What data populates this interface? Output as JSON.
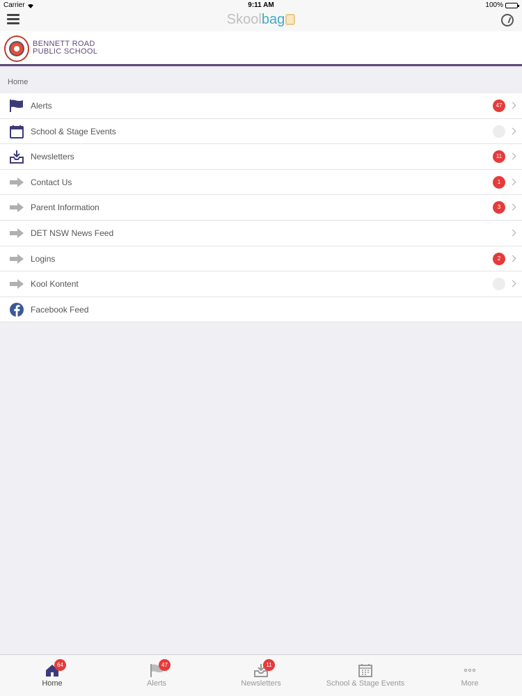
{
  "status_bar": {
    "carrier": "Carrier",
    "time": "9:11 AM",
    "battery": "100%"
  },
  "nav": {
    "brand_part1": "Skool",
    "brand_part2": "bag"
  },
  "school": {
    "name_line1": "BENNETT ROAD",
    "name_line2": "PUBLIC SCHOOL"
  },
  "breadcrumb": "Home",
  "menu": {
    "items": [
      {
        "label": "Alerts",
        "badge": "47",
        "icon": "flag-icon"
      },
      {
        "label": "School & Stage Events",
        "badge": "",
        "icon": "calendar-icon"
      },
      {
        "label": "Newsletters",
        "badge": "11",
        "icon": "inbox-download-icon"
      },
      {
        "label": "Contact Us",
        "badge": "1",
        "icon": "arrow-right-icon"
      },
      {
        "label": "Parent Information",
        "badge": "3",
        "icon": "arrow-right-icon"
      },
      {
        "label": "DET NSW News Feed",
        "badge": "",
        "icon": "arrow-right-icon"
      },
      {
        "label": "Logins",
        "badge": "2",
        "icon": "arrow-right-icon"
      },
      {
        "label": "Kool Kontent",
        "badge": "",
        "icon": "arrow-right-icon"
      },
      {
        "label": "Facebook Feed",
        "badge": "",
        "icon": "facebook-icon"
      }
    ]
  },
  "tabs": [
    {
      "label": "Home",
      "badge": "64",
      "icon": "home-icon"
    },
    {
      "label": "Alerts",
      "badge": "47",
      "icon": "flag-icon"
    },
    {
      "label": "Newsletters",
      "badge": "11",
      "icon": "inbox-download-icon"
    },
    {
      "label": "School & Stage Events",
      "badge": "",
      "icon": "calendar-icon"
    },
    {
      "label": "More",
      "badge": "",
      "icon": "more-icon"
    }
  ],
  "colors": {
    "accent": "#5f4b7a",
    "badge": "#e53b3b",
    "brand_blue": "#42a9c6",
    "facebook": "#3b5998"
  }
}
